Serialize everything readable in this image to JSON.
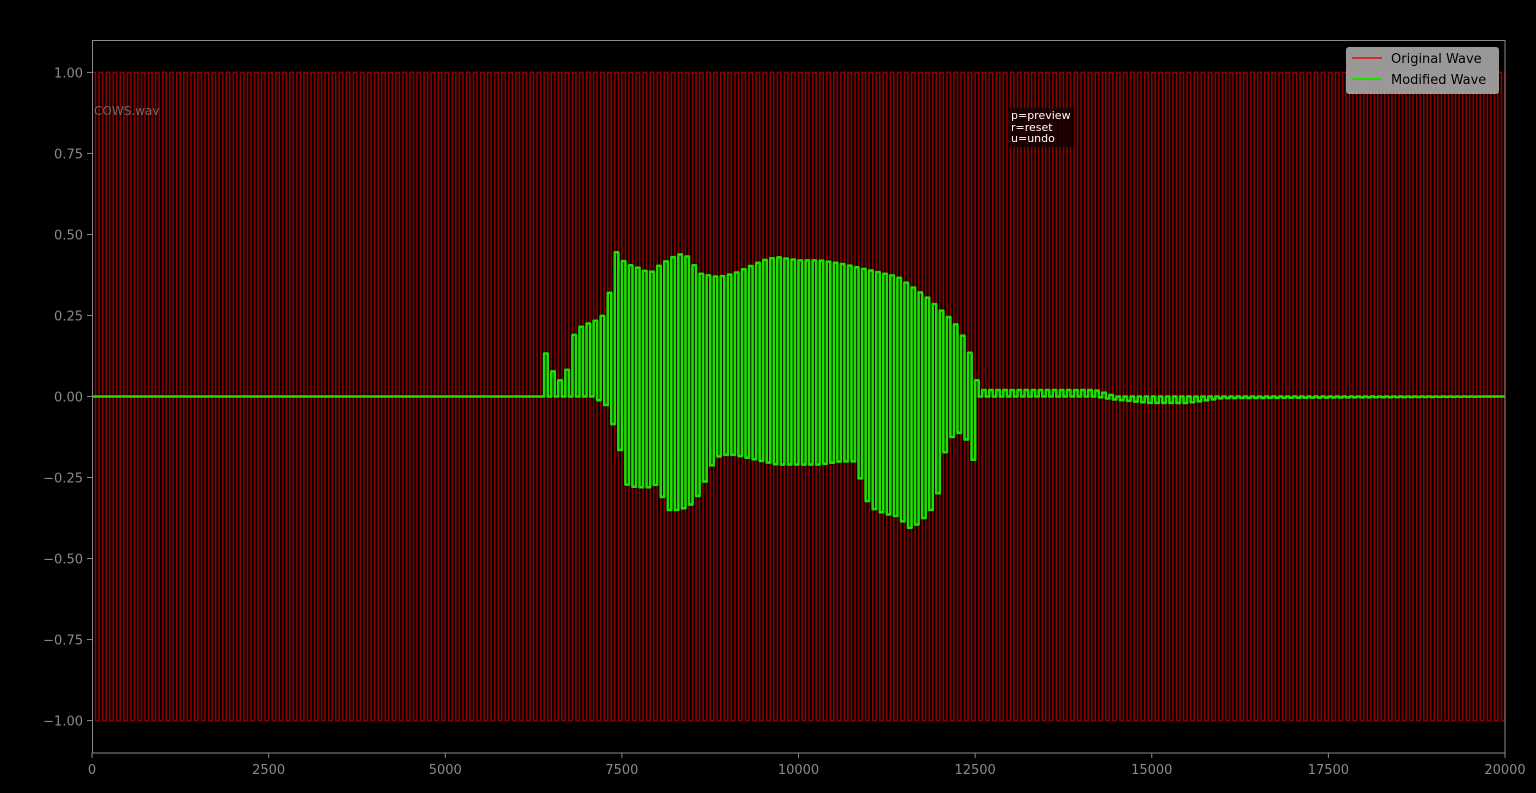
{
  "file_label": "COWS.wav",
  "help_lines": [
    "p=preview",
    "r=reset",
    "u=undo"
  ],
  "colors": {
    "background": "#000000",
    "axes_frame": "#8a8a8a",
    "original": "#8b0000",
    "original_legend": "#d03030",
    "modified": "#22dd00",
    "legend_bg": "#a0a0a0"
  },
  "chart_data": {
    "type": "line",
    "xlim": [
      0,
      20000
    ],
    "ylim": [
      -1.1,
      1.1
    ],
    "xticks": [
      0,
      2500,
      5000,
      7500,
      10000,
      12500,
      15000,
      17500,
      20000
    ],
    "xtick_labels": [
      "0",
      "2500",
      "5000",
      "7500",
      "10000",
      "12500",
      "15000",
      "17500",
      "20000"
    ],
    "yticks": [
      1.0,
      0.75,
      0.5,
      0.25,
      0.0,
      -0.25,
      -0.5,
      -0.75,
      -1.0
    ],
    "ytick_labels": [
      "1.00",
      "0.75",
      "0.50",
      "0.25",
      "0.00",
      "−0.25",
      "−0.50",
      "−0.75",
      "−1.00"
    ],
    "legend_position": "top-right",
    "grid": false,
    "series": [
      {
        "name": "Original Wave",
        "kind": "square",
        "period": 100,
        "amplitude": 1.0,
        "x_range": [
          0,
          20000
        ]
      },
      {
        "name": "Modified Wave",
        "kind": "square-envelope",
        "period": 100,
        "x": [
          0,
          6380,
          6420,
          6440,
          6520,
          6580,
          6700,
          6800,
          6850,
          6950,
          7100,
          7300,
          7350,
          7400,
          7450,
          7550,
          7700,
          7900,
          8000,
          8150,
          8300,
          8450,
          8600,
          8800,
          8900,
          9100,
          9300,
          9500,
          9700,
          10000,
          10300,
          10600,
          10800,
          11000,
          11200,
          11400,
          11600,
          11800,
          11950,
          12100,
          12200,
          12300,
          12400,
          12450,
          12500,
          12550,
          13000,
          13500,
          14000,
          14200,
          14500,
          15000,
          15500,
          16000,
          20000
        ],
        "upper": [
          0,
          0,
          0.14,
          0.11,
          0.08,
          0.05,
          0.05,
          0.18,
          0.2,
          0.22,
          0.23,
          0.26,
          0.38,
          0.45,
          0.44,
          0.41,
          0.4,
          0.38,
          0.4,
          0.42,
          0.44,
          0.43,
          0.38,
          0.37,
          0.37,
          0.38,
          0.4,
          0.42,
          0.43,
          0.42,
          0.42,
          0.41,
          0.4,
          0.39,
          0.38,
          0.37,
          0.34,
          0.31,
          0.28,
          0.25,
          0.23,
          0.2,
          0.15,
          0.12,
          0.08,
          0.02,
          0.02,
          0.02,
          0.02,
          0.02,
          0.0,
          0.0,
          0.0,
          0.0,
          0.0
        ],
        "lower": [
          0,
          0,
          0,
          0,
          0,
          0,
          0,
          0,
          0,
          0,
          0,
          -0.03,
          -0.07,
          -0.1,
          -0.13,
          -0.27,
          -0.28,
          -0.28,
          -0.27,
          -0.35,
          -0.35,
          -0.34,
          -0.3,
          -0.2,
          -0.18,
          -0.18,
          -0.19,
          -0.2,
          -0.21,
          -0.21,
          -0.21,
          -0.2,
          -0.2,
          -0.34,
          -0.36,
          -0.37,
          -0.41,
          -0.37,
          -0.33,
          -0.14,
          -0.12,
          -0.11,
          -0.14,
          -0.19,
          -0.2,
          0.0,
          0.0,
          0.0,
          0.0,
          0.0,
          -0.01,
          -0.02,
          -0.02,
          -0.005,
          0.0
        ]
      }
    ]
  }
}
